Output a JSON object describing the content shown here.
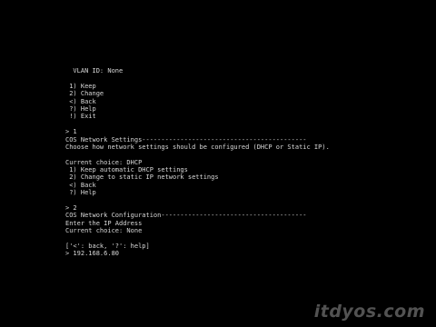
{
  "console": {
    "lines": [
      "  VLAN ID: None",
      "",
      " 1) Keep",
      " 2) Change",
      " <) Back",
      " ?) Help",
      " !) Exit",
      "",
      "> 1",
      "COS Network Settings-------------------------------------------",
      "Choose how network settings should be configured (DHCP or Static IP).",
      "",
      "Current choice: DHCP",
      " 1) Keep automatic DHCP settings",
      " 2) Change to static IP network settings",
      " <) Back",
      " ?) Help",
      "",
      "> 2",
      "COS Network Configuration--------------------------------------",
      "Enter the IP Address",
      "Current choice: None",
      "",
      "['<': back, '?': help]",
      "> 192.168.6.80"
    ]
  },
  "watermark": {
    "text": "itdyos.com"
  },
  "colors": {
    "background": "#000000",
    "text": "#d8d8d8",
    "watermark": "#969696"
  }
}
